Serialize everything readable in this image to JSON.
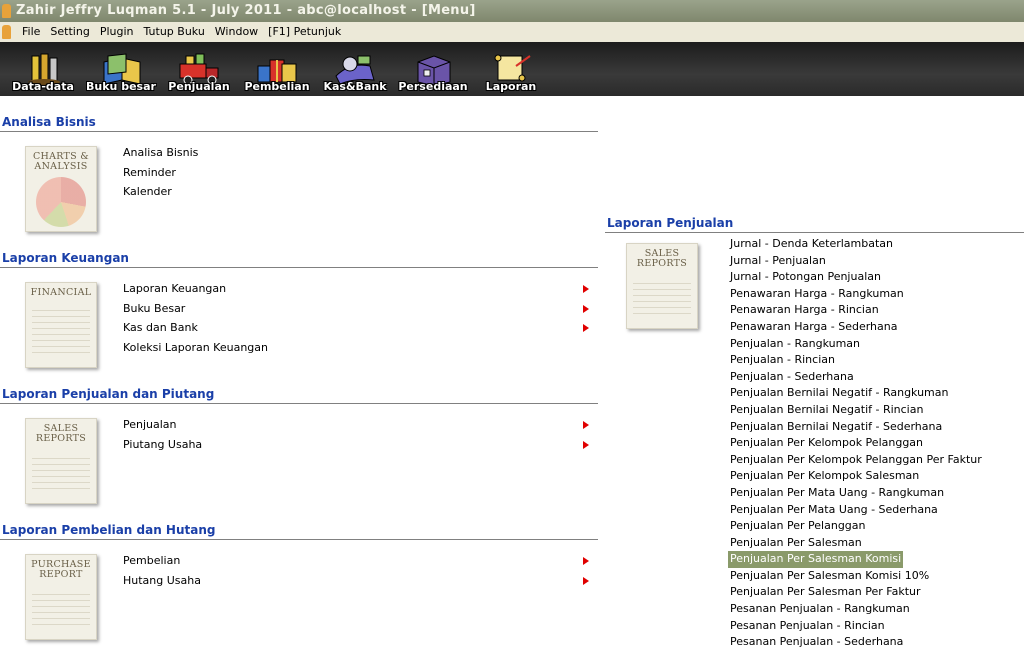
{
  "window": {
    "title": "Zahir Jeffry Luqman 5.1 - July 2011 - abc@localhost - [Menu]"
  },
  "menubar": {
    "items": [
      "File",
      "Setting",
      "Plugin",
      "Tutup Buku",
      "Window",
      "[F1] Petunjuk"
    ]
  },
  "toolbar": {
    "items": [
      {
        "label": "Data-data",
        "icon": "data-icon"
      },
      {
        "label": "Buku besar",
        "icon": "ledger-icon"
      },
      {
        "label": "Penjualan",
        "icon": "sales-truck-icon"
      },
      {
        "label": "Pembelian",
        "icon": "purchase-gifts-icon"
      },
      {
        "label": "Kas&Bank",
        "icon": "cash-bank-icon"
      },
      {
        "label": "Persediaan",
        "icon": "inventory-box-icon"
      },
      {
        "label": "Laporan",
        "icon": "report-scroll-icon"
      }
    ]
  },
  "sections": {
    "analisa": {
      "title": "Analisa Bisnis",
      "thumb": [
        "CHARTS &",
        "ANALYSIS"
      ],
      "items": [
        "Analisa Bisnis",
        "Reminder",
        "Kalender"
      ]
    },
    "keuangan": {
      "title": "Laporan Keuangan",
      "thumb": [
        "FINANCIAL",
        ""
      ],
      "items": [
        "Laporan Keuangan",
        "Buku Besar",
        "Kas dan Bank",
        "Koleksi Laporan Keuangan"
      ]
    },
    "penjualan_piutang": {
      "title": "Laporan Penjualan dan Piutang",
      "thumb": [
        "SALES",
        "REPORTS"
      ],
      "items": [
        "Penjualan",
        "Piutang Usaha"
      ]
    },
    "pembelian_hutang": {
      "title": "Laporan Pembelian dan Hutang",
      "thumb": [
        "PURCHASE",
        "REPORT"
      ],
      "items": [
        "Pembelian",
        "Hutang Usaha"
      ]
    },
    "laporan_penjualan": {
      "title": "Laporan Penjualan",
      "thumb": [
        "SALES",
        "REPORTS"
      ],
      "items": [
        "Jurnal - Denda Keterlambatan",
        "Jurnal - Penjualan",
        "Jurnal - Potongan Penjualan",
        "Penawaran Harga - Rangkuman",
        "Penawaran Harga - Rincian",
        "Penawaran Harga - Sederhana",
        "Penjualan - Rangkuman",
        "Penjualan - Rincian",
        "Penjualan - Sederhana",
        "Penjualan Bernilai Negatif - Rangkuman",
        "Penjualan Bernilai Negatif - Rincian",
        "Penjualan Bernilai Negatif - Sederhana",
        "Penjualan Per Kelompok Pelanggan",
        "Penjualan Per Kelompok Pelanggan Per Faktur",
        "Penjualan Per Kelompok Salesman",
        "Penjualan Per Mata Uang - Rangkuman",
        "Penjualan Per Mata Uang - Sederhana",
        "Penjualan Per Pelanggan",
        "Penjualan Per Salesman",
        "Penjualan Per Salesman Komisi",
        "Penjualan Per Salesman Komisi 10%",
        "Penjualan Per Salesman Per Faktur",
        "Pesanan Penjualan - Rangkuman",
        "Pesanan Penjualan - Rincian",
        "Pesanan Penjualan - Sederhana"
      ],
      "selected_index": 19
    }
  },
  "colors": {
    "section_title": "#1a3fa8",
    "arrow": "#e00000",
    "selected_bg": "#8a9a6a",
    "toolbar_bg": "#2a2a2a"
  }
}
